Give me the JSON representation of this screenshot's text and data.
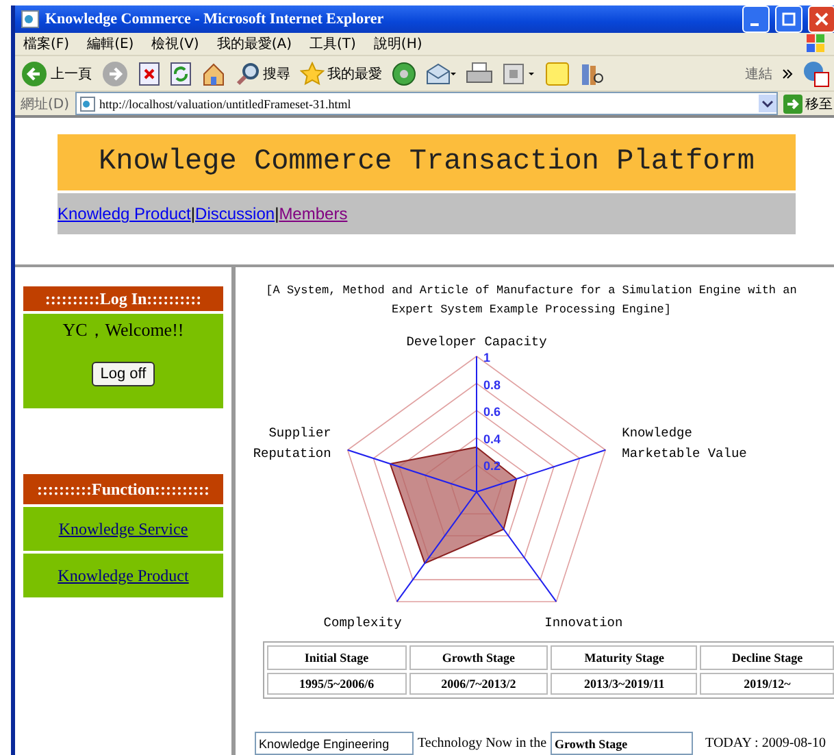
{
  "window": {
    "title": "Knowledge Commerce - Microsoft Internet Explorer"
  },
  "menu": [
    "檔案(F)",
    "編輯(E)",
    "檢視(V)",
    "我的最愛(A)",
    "工具(T)",
    "說明(H)"
  ],
  "toolbar": {
    "buttons": [
      {
        "kind": "back",
        "label": "上一頁"
      },
      {
        "kind": "forward"
      },
      {
        "kind": "stop"
      },
      {
        "kind": "refresh"
      },
      {
        "kind": "home"
      },
      {
        "kind": "search",
        "label": "搜尋"
      },
      {
        "kind": "favorites",
        "label": "我的最愛"
      },
      {
        "kind": "media"
      },
      {
        "kind": "mail"
      },
      {
        "kind": "print"
      },
      {
        "kind": "edit"
      },
      {
        "kind": "notes"
      },
      {
        "kind": "research"
      }
    ],
    "links": "連結"
  },
  "address": {
    "label": "網址(D)",
    "url": "http://localhost/valuation/untitledFrameset-31.html",
    "go": "移至"
  },
  "header": {
    "title": "Knowlege Commerce Transaction Platform"
  },
  "nav": [
    {
      "label": "Knowledg Product",
      "visited": false,
      "separator": "|"
    },
    {
      "label": "Discussion",
      "visited": false,
      "separator": "|"
    },
    {
      "label": "Members",
      "visited": true
    }
  ],
  "login": {
    "heading": "::::::::::Log In::::::::::",
    "welcome": "YC，Welcome!!",
    "button": "Log off"
  },
  "functions": {
    "heading": "::::::::::Function::::::::::",
    "items": [
      "Knowledge Service",
      "Knowledge Product"
    ]
  },
  "content": {
    "title": "[A System, Method and Article of Manufacture for a Simulation Engine with an Expert System Example Processing Engine]",
    "chart_data": {
      "type": "radar",
      "categories": [
        "Developer Capacity",
        "Knowledge Marketable Value",
        "Innovation",
        "Complexity",
        "Supplier Reputation"
      ],
      "yticks": [
        0.2,
        0.4,
        0.6,
        0.8,
        1
      ],
      "ylim": [
        0,
        1
      ],
      "series": [
        {
          "color": "#b46464",
          "values": [
            0.33,
            0.31,
            0.34,
            0.65,
            0.67
          ]
        }
      ]
    },
    "stages": {
      "columns": [
        "Initial Stage",
        "Growth Stage",
        "Maturity Stage",
        "Decline Stage"
      ],
      "rows": [
        [
          "1995/5~2006/6",
          "2006/7~2013/2",
          "2013/3~2019/11",
          "2019/12~"
        ]
      ]
    },
    "field": "Knowledge Engineering",
    "sentence": "Technology Now in the",
    "stage": "Growth Stage",
    "today": "TODAY : 2009-08-10"
  }
}
